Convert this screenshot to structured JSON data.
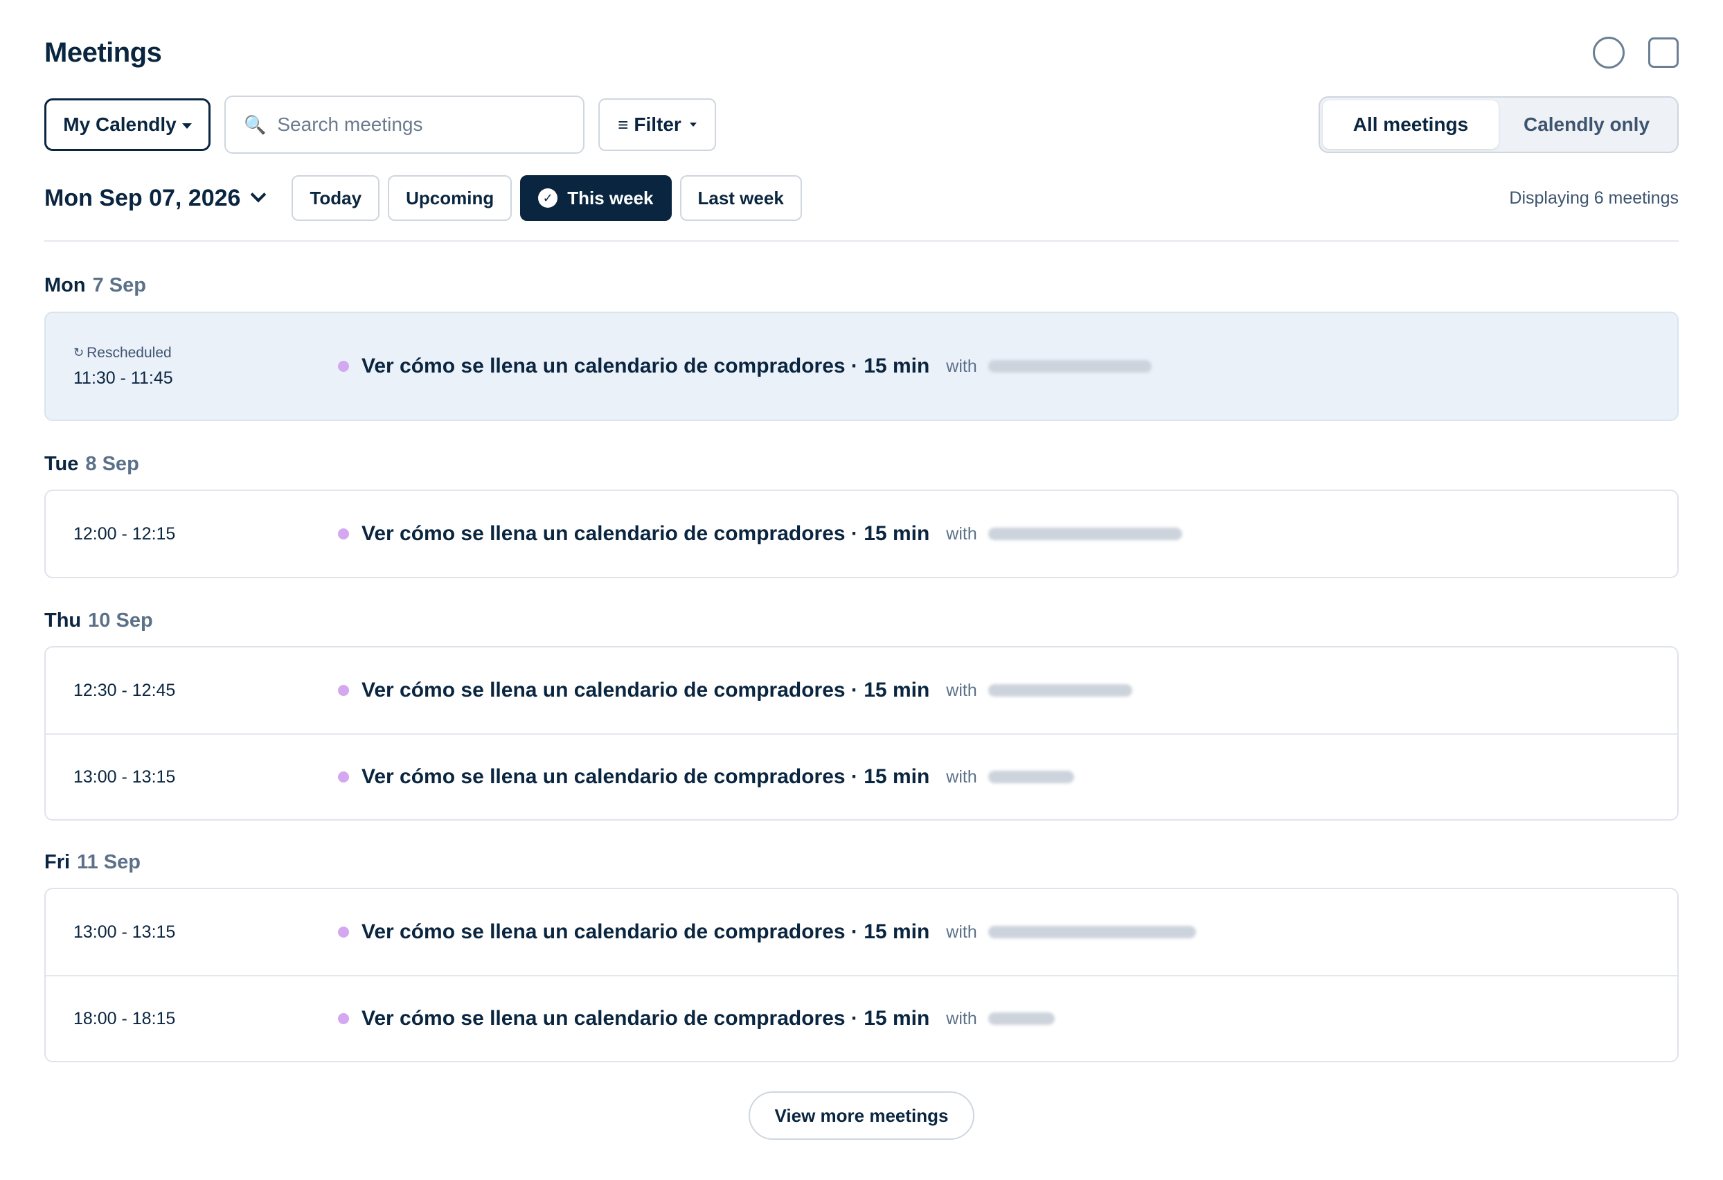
{
  "header": {
    "title": "Meetings",
    "icons": [
      "circle-icon",
      "square-icon"
    ]
  },
  "toolbar": {
    "calendar_select": "My Calendly",
    "search_placeholder": "Search meetings",
    "filter_label": "Filter",
    "segments": [
      "All meetings",
      "Calendly only"
    ],
    "active_segment": "All meetings"
  },
  "date_bar": {
    "selected_date": "Mon Sep 07, 2026",
    "ranges": [
      "Today",
      "Upcoming",
      "This week",
      "Last week"
    ],
    "active_range": "This week",
    "displaying": "Displaying 6 meetings"
  },
  "days": [
    {
      "day": "Mon",
      "date": "7 Sep",
      "meetings": [
        {
          "status": "Rescheduled",
          "time": "11:30 - 11:45",
          "title": "Ver cómo se llena un calendario de compradores · 15 min",
          "with": "with"
        }
      ]
    },
    {
      "day": "Tue",
      "date": "8 Sep",
      "meetings": [
        {
          "time": "12:00 - 12:15",
          "title": "Ver cómo se llena un calendario de compradores · 15 min",
          "with": "with"
        }
      ]
    },
    {
      "day": "Thu",
      "date": "10 Sep",
      "meetings": [
        {
          "time": "12:30 - 12:45",
          "title": "Ver cómo se llena un calendario de compradores · 15 min",
          "with": "with"
        },
        {
          "time": "13:00 - 13:15",
          "title": "Ver cómo se llena un calendario de compradores · 15 min",
          "with": "with"
        }
      ]
    },
    {
      "day": "Fri",
      "date": "11 Sep",
      "meetings": [
        {
          "time": "13:00 - 13:15",
          "title": "Ver cómo se llena un calendario de compradores · 15 min",
          "with": "with"
        },
        {
          "time": "18:00 - 18:15",
          "title": "Ver cómo se llena un calendario de compradores · 15 min",
          "with": "with"
        }
      ]
    }
  ],
  "footer": {
    "view_more": "View more meetings"
  },
  "colors": {
    "primary": "#0a2540",
    "event_dot": "#d4a8f0",
    "highlight_row": "#ebf1f9"
  }
}
